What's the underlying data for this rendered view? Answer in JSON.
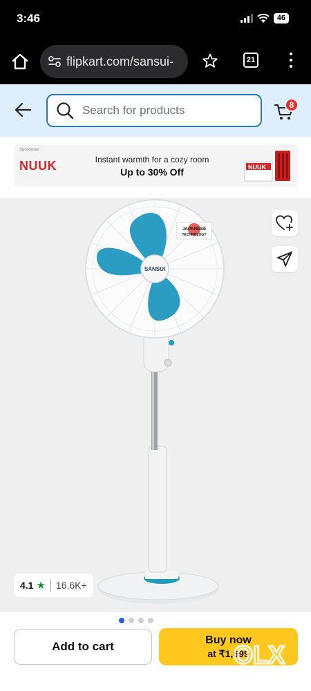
{
  "status_bar": {
    "time": "3:46",
    "battery": "46",
    "icons": [
      "cellular-signal-icon",
      "wifi-icon",
      "battery-icon"
    ]
  },
  "browser": {
    "url": "flipkart.com/sansui-",
    "tab_count": "21",
    "icons": [
      "home-icon",
      "site-settings-icon",
      "bookmark-star-icon",
      "tabs-icon",
      "more-options-icon"
    ]
  },
  "header": {
    "search_placeholder": "Search for products",
    "cart_count": "8",
    "accent_color": "#2a7ab8"
  },
  "ad": {
    "sponsor_label": "Sponsored",
    "brand": "NUUK",
    "line1": "Instant warmth for a cozy room",
    "line2": "Up to 30% Off"
  },
  "product": {
    "brand_on_fan": "SANSUI",
    "badge_line1": "JAPANESE",
    "badge_line2": "TECHNOLOGY",
    "rating": "4.1",
    "rating_star": "★",
    "rating_count": "16.6K+",
    "image_dots": {
      "total": 4,
      "active": 0
    }
  },
  "actions": {
    "add_to_cart": "Add to cart",
    "buy_now": "Buy now",
    "buy_price": "at ₹1,699",
    "buy_color": "#ffc81f"
  },
  "watermark": {
    "logo": "OLX"
  }
}
